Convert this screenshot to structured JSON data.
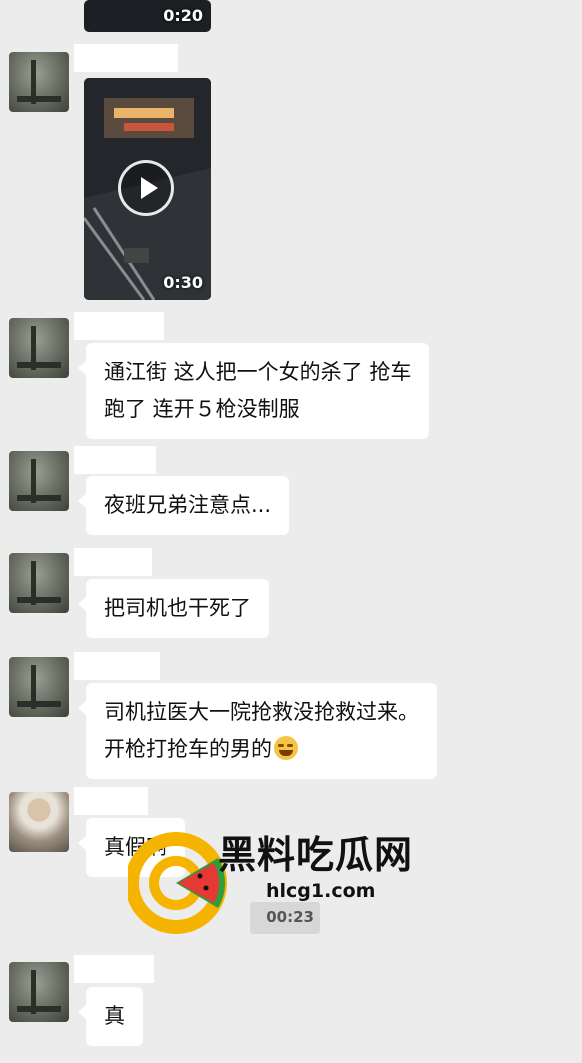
{
  "video_top": {
    "duration": "0:20"
  },
  "video_main": {
    "duration": "0:30"
  },
  "video_small": {
    "duration": "00:23"
  },
  "messages": [
    {
      "text_lines": [
        "通江街 这人把一个女的杀了 抢车",
        "跑了 连开５枪没制服"
      ]
    },
    {
      "text": "夜班兄弟注意点..."
    },
    {
      "text": "把司机也干死了"
    },
    {
      "text_lines": [
        "司机拉医大一院抢救没抢救过来。",
        "开枪打抢车的男的"
      ],
      "emoji": "rolling-laughing-emoji"
    },
    {
      "text": "真假啊"
    },
    {
      "text": "真"
    }
  ],
  "watermark": {
    "brand": "黑料吃瓜网",
    "url": "hlcg1.com",
    "colors": {
      "ring": "#f5b400",
      "watermelon_rind": "#2e9e3a",
      "watermelon_flesh": "#e53935"
    }
  },
  "colors": {
    "background": "#ececec",
    "bubble": "#ffffff",
    "text": "#111111"
  }
}
